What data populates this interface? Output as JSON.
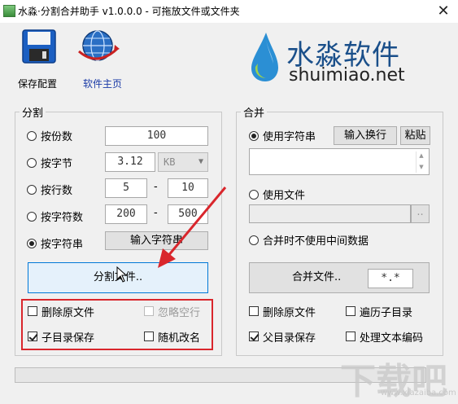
{
  "window": {
    "title": "水淼·分割合并助手 v1.0.0.0 - 可拖放文件或文件夹",
    "close_glyph": "✕"
  },
  "toolbar": {
    "save_config": "保存配置",
    "homepage": "软件主页"
  },
  "brand": {
    "name": "水淼软件",
    "domain": "shuimiao.net"
  },
  "split": {
    "title": "分割",
    "by_count": {
      "label": "按份数",
      "value": "100"
    },
    "by_bytes": {
      "label": "按字节",
      "value": "3.12",
      "unit": "KB"
    },
    "by_lines": {
      "label": "按行数",
      "from": "5",
      "to": "10"
    },
    "by_chars": {
      "label": "按字符数",
      "from": "200",
      "to": "500"
    },
    "by_string": {
      "label": "按字符串",
      "button": "输入字符串"
    },
    "range_sep": "-",
    "action": "分割文件..",
    "options": {
      "delete_source": "删除原文件",
      "ignore_blank": "忽略空行",
      "save_subdir": "子目录保存",
      "random_rename": "随机改名"
    }
  },
  "merge": {
    "title": "合并",
    "use_string": "使用字符串",
    "input_newline": "输入换行",
    "paste": "粘贴",
    "use_file": "使用文件",
    "browse": "..",
    "no_temp": "合并时不使用中间数据",
    "action": "合并文件..",
    "pattern": "*.*",
    "options": {
      "delete_source": "删除原文件",
      "traverse_subdirs": "遍历子目录",
      "save_parent": "父目录保存",
      "handle_encoding": "处理文本编码"
    }
  },
  "watermark": {
    "text": "下载吧",
    "sub": "www.xiazaiba.com"
  },
  "colors": {
    "highlight_red": "#d9262c",
    "brand_blue": "#1a4f8a",
    "link_blue": "#1a3aa6"
  }
}
